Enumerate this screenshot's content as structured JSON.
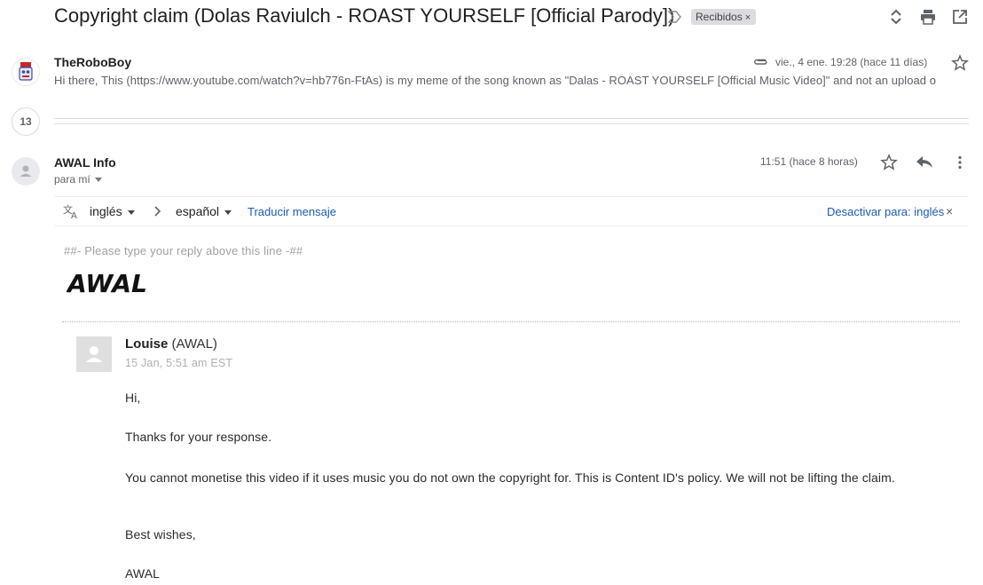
{
  "subject": "Copyright claim (Dolas Raviulch - ROAST YOURSELF [Official Parody])",
  "label": {
    "text": "Recibidos",
    "remove": "×"
  },
  "icons": {
    "importance": "importance-marker-icon",
    "expand": "expand-collapse-icon",
    "print": "printer-icon",
    "open_new": "open-in-new-window-icon"
  },
  "message1": {
    "sender": "TheRoboBoy",
    "attachment_icon": "paperclip-icon",
    "date": "vie., 4 ene. 19:28 (hace 11 días)",
    "snippet": "Hi there, This (https://www.youtube.com/watch?v=hb776n-FtAs) is my meme of the song known as \"Dalas - ROAST YOURSELF [Official Music Video]\" and not an upload o"
  },
  "collapsed_count": "13",
  "message2": {
    "sender": "AWAL Info",
    "to": "para mí",
    "time": "11:51 (hace 8 horas)"
  },
  "translate": {
    "source_lang": "inglés",
    "target_lang": "español",
    "translate_link": "Traducir mensaje",
    "disable_link": "Desactivar para: inglés",
    "close": "×"
  },
  "body": {
    "reply_line": "##- Please type your reply above this line -##",
    "logo": "AWAL",
    "author_name": "Louise",
    "author_org": "(AWAL)",
    "timestamp": "15 Jan, 5:51 am EST",
    "greeting": "Hi,",
    "p1": "Thanks for your response.",
    "p2": "You cannot monetise this video if it uses music you do not own the copyright for. This is Content ID's policy. We will not be lifting the claim.",
    "closing": "Best wishes,",
    "signature": "AWAL"
  },
  "colors": {
    "link": "#1a5bb5",
    "chip": "#dadce0",
    "muted": "#5f6368"
  }
}
